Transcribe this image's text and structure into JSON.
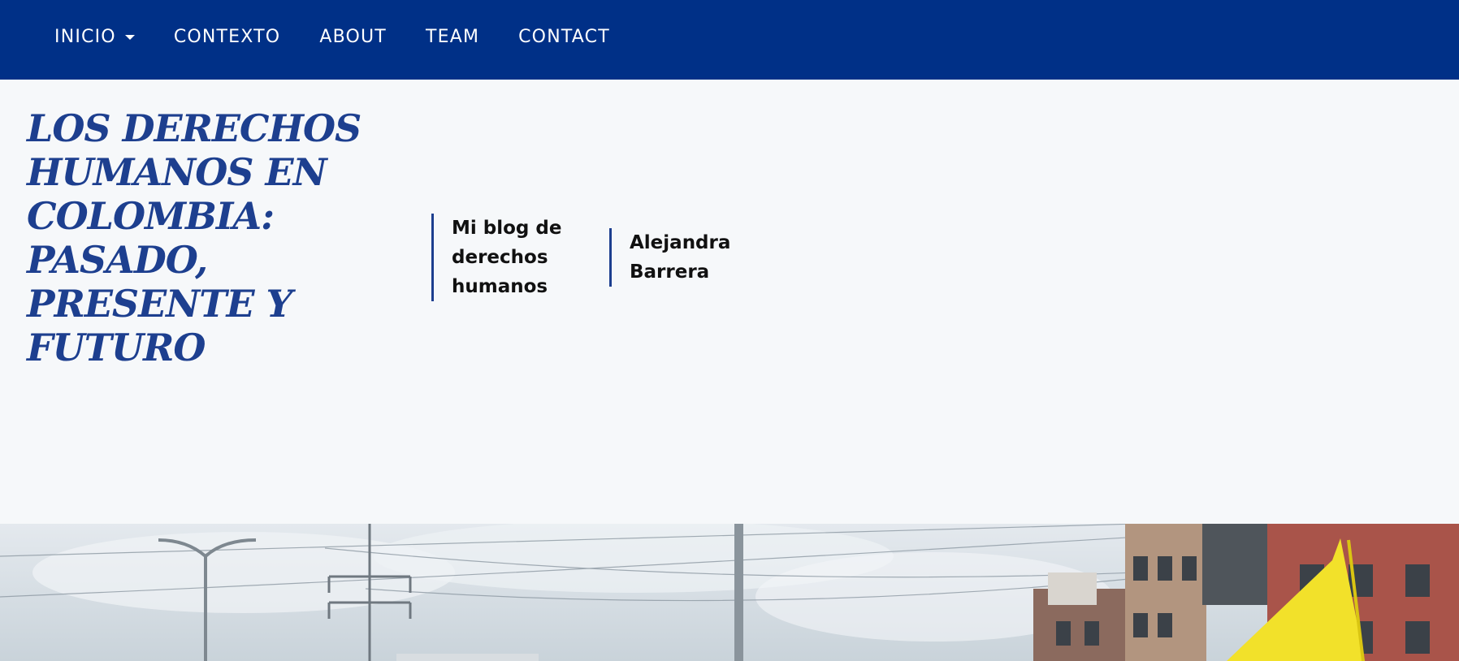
{
  "nav": {
    "items": [
      {
        "label": "INICIO",
        "has_dropdown": true
      },
      {
        "label": "CONTEXTO",
        "has_dropdown": false
      },
      {
        "label": "ABOUT",
        "has_dropdown": false
      },
      {
        "label": "TEAM",
        "has_dropdown": false
      },
      {
        "label": "CONTACT",
        "has_dropdown": false
      }
    ]
  },
  "header": {
    "title": "LOS DERECHOS HUMANOS EN COLOMBIA: PASADO, PRESENTE Y FUTURO",
    "blog_label": "Mi blog de derechos humanos",
    "author": "Alejandra Barrera"
  },
  "colors": {
    "navbar_bg": "#003087",
    "title": "#1d3f8f",
    "page_bg": "#f6f8fa",
    "flag_yellow": "#f2e12a"
  },
  "hero_image": {
    "icon": "protest-photo-icon"
  }
}
